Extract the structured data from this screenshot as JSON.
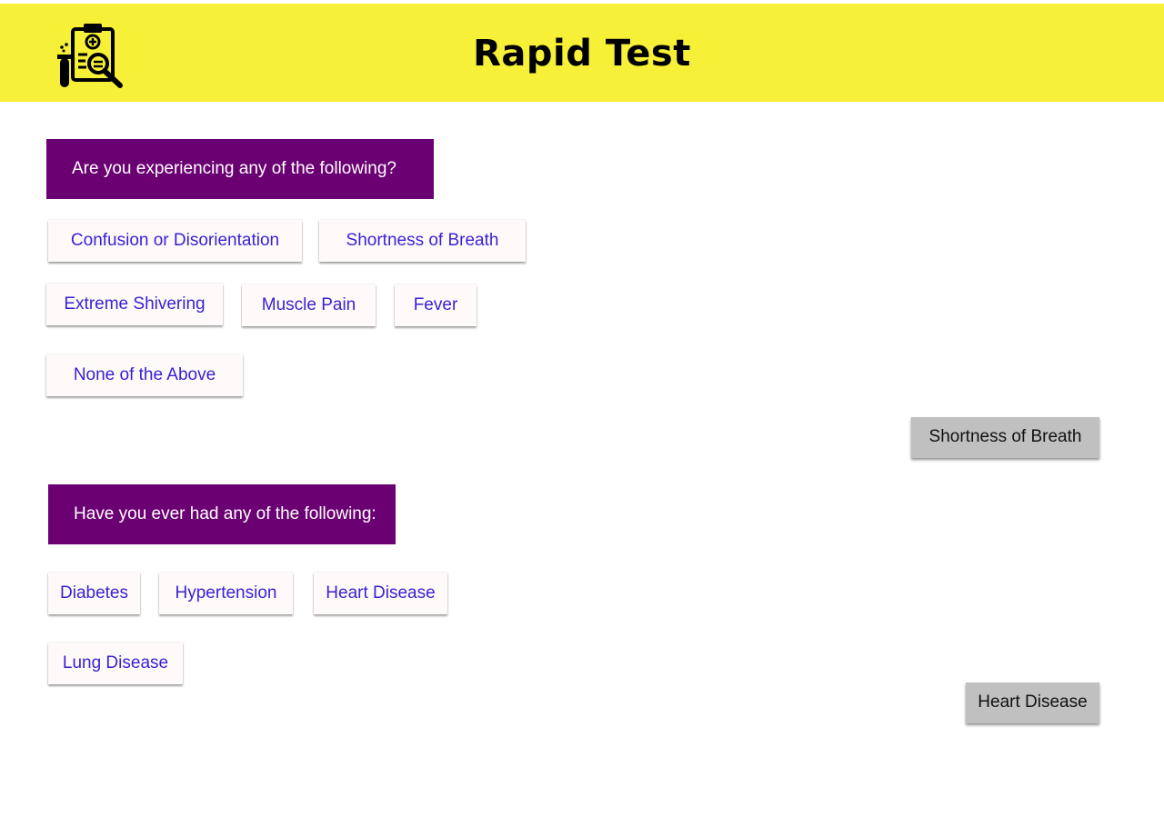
{
  "header": {
    "title": "Rapid Test",
    "logo_icon": "medical-test-clipboard-icon",
    "background_color": "#f6f038"
  },
  "colors": {
    "question_bg": "#6b0073",
    "option_text": "#3b1fd2",
    "answer_bg": "#c0c0c0"
  },
  "question1": {
    "text": "Are you experiencing any of the following?",
    "options": [
      "Confusion or Disorientation",
      "Shortness of Breath",
      "Extreme Shivering",
      "Muscle Pain",
      "Fever",
      "None of the Above"
    ],
    "selected_answer": "Shortness of Breath"
  },
  "question2": {
    "text": "Have you ever had any of the following:",
    "options": [
      "Diabetes",
      "Hypertension",
      "Heart Disease",
      "Lung Disease"
    ],
    "selected_answer": "Heart Disease"
  }
}
